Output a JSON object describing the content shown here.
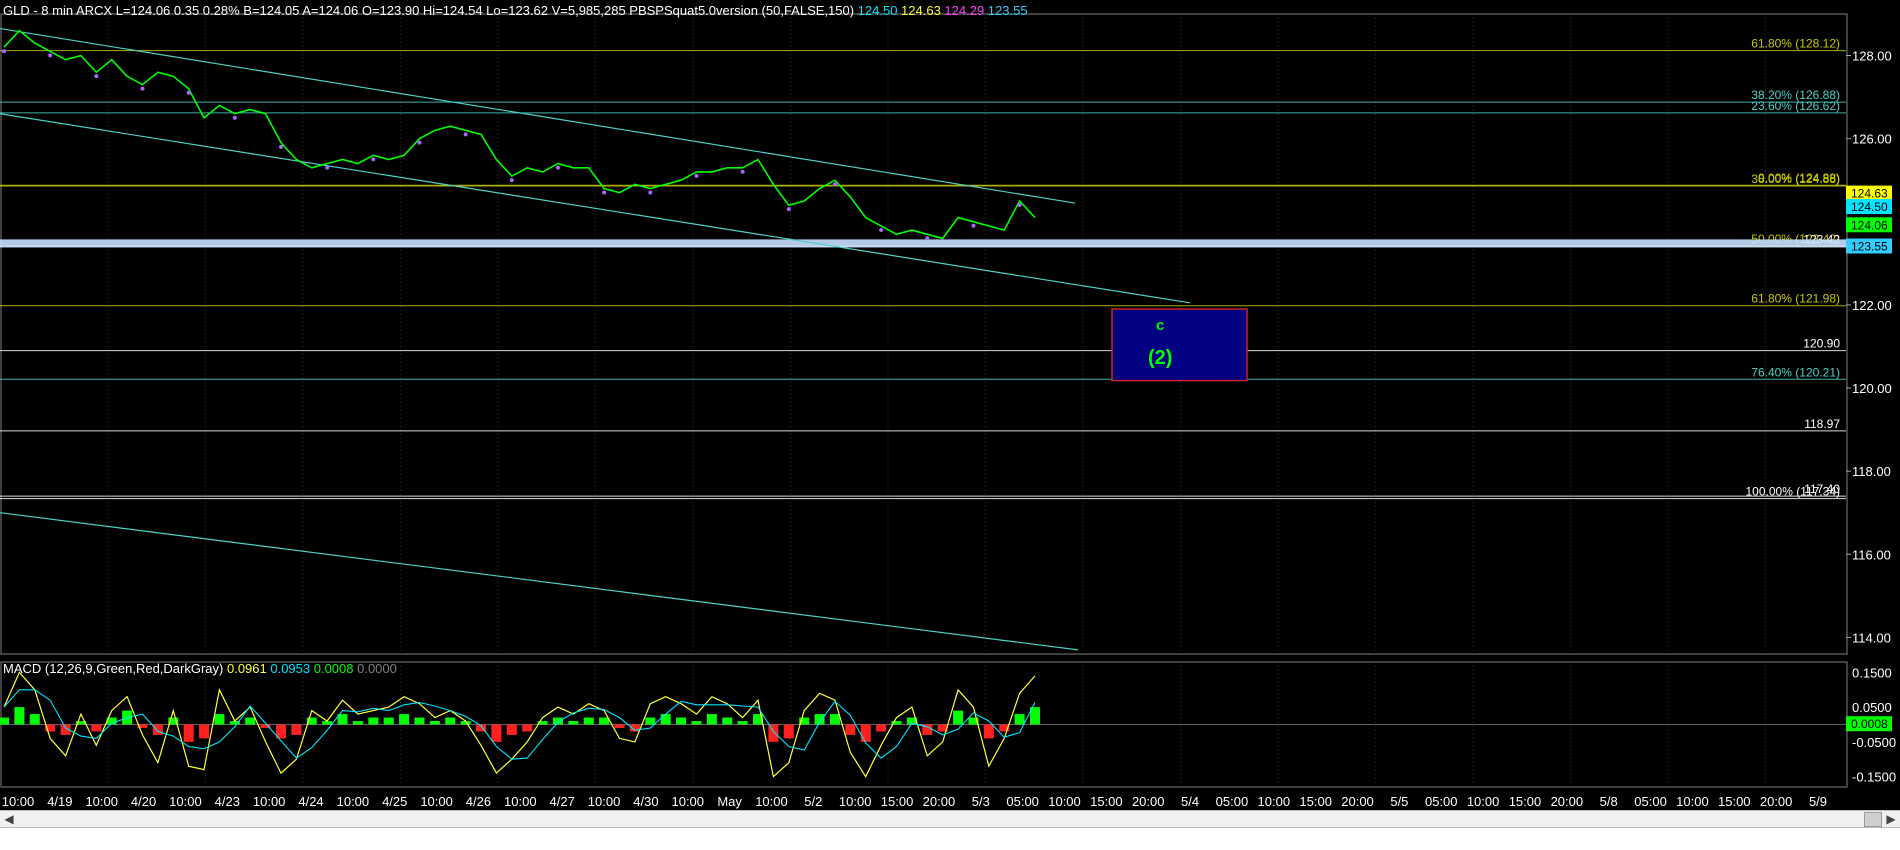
{
  "header": {
    "parts": [
      {
        "text": "GLD - 8 min  ARCX  L=124.06  0.35   0.28%",
        "color": "#ffffff"
      },
      {
        "text": "B=124.05  A=124.06  O=123.90  Hi=124.54  Lo=123.62  V=5,985,285  PBSPSquat5.0version (50,FALSE,150)",
        "color": "#ffffff"
      },
      {
        "text": "124.50",
        "color": "#00e5ff"
      },
      {
        "text": "124.63",
        "color": "#ffff33"
      },
      {
        "text": "124.29",
        "color": "#ff44ff"
      },
      {
        "text": "123.55",
        "color": "#33ccff"
      }
    ]
  },
  "macd_header": {
    "parts": [
      {
        "text": "MACD (12,26,9,Green,Red,DarkGray)",
        "color": "#ffffff"
      },
      {
        "text": "0.0961",
        "color": "#ffff33"
      },
      {
        "text": "0.0953",
        "color": "#00e5ff"
      },
      {
        "text": "0.0008",
        "color": "#00ff00"
      },
      {
        "text": "0.0000",
        "color": "#808080"
      }
    ]
  },
  "price_axis": {
    "ticks": [
      "128.00",
      "126.00",
      "124.00",
      "122.00",
      "120.00",
      "118.00",
      "116.00",
      "114.00"
    ]
  },
  "macd_axis": {
    "ticks": [
      "0.1500",
      "0.0500",
      "-0.0500",
      "-0.1500"
    ]
  },
  "price_tags": [
    {
      "text": "124.63",
      "color": "#ffff00",
      "text_color": "#000"
    },
    {
      "text": "124.50",
      "color": "#00e5ff",
      "text_color": "#000"
    },
    {
      "text": "124.06",
      "color": "#00ff00",
      "text_color": "#000"
    },
    {
      "text": "123.55",
      "color": "#33ccff",
      "text_color": "#000"
    }
  ],
  "macd_tag": {
    "text": "0.0008",
    "color": "#00ff00",
    "text_color": "#000"
  },
  "x_labels": [
    "10:00",
    "4/19",
    "10:00",
    "4/20",
    "10:00",
    "4/23",
    "10:00",
    "4/24",
    "10:00",
    "4/25",
    "10:00",
    "4/26",
    "10:00",
    "4/27",
    "10:00",
    "4/30",
    "10:00",
    "May",
    "10:00",
    "5/2",
    "10:00",
    "15:00",
    "20:00",
    "5/3",
    "05:00",
    "10:00",
    "15:00",
    "20:00",
    "5/4",
    "05:00",
    "10:00",
    "15:00",
    "20:00",
    "5/5",
    "05:00",
    "10:00",
    "15:00",
    "20:00",
    "5/8",
    "05:00",
    "10:00",
    "15:00",
    "20:00",
    "5/9"
  ],
  "fib_levels": [
    {
      "label": "61.80% (128.12)",
      "price": 128.12,
      "color": "#c8c800"
    },
    {
      "label": "38.20% (126.88)",
      "price": 126.88,
      "color": "#4fd0c8"
    },
    {
      "label": "23.60% (126.62)",
      "price": 126.62,
      "color": "#4fd0c8"
    },
    {
      "label": "0.00% (124.88)",
      "price": 124.88,
      "color": "#c8c800"
    },
    {
      "label": "38.00% (124.88)",
      "price": 124.86,
      "color": "#c8c800"
    },
    {
      "label": "50.00% (123.42)",
      "price": 123.42,
      "color": "#c8c800"
    },
    {
      "label": "123.42",
      "price": 123.4,
      "color": "#ffffff"
    },
    {
      "label": "61.80% (121.98)",
      "price": 121.98,
      "color": "#c8c800"
    },
    {
      "label": "120.90",
      "price": 120.9,
      "color": "#ffffff"
    },
    {
      "label": "76.40% (120.21)",
      "price": 120.21,
      "color": "#4fd0c8"
    },
    {
      "label": "118.97",
      "price": 118.97,
      "color": "#ffffff"
    },
    {
      "label": "100.00% (117.34)",
      "price": 117.34,
      "color": "#ffffff"
    },
    {
      "label": "117.40",
      "price": 117.4,
      "color": "#ffffff"
    }
  ],
  "target_box": {
    "label_top": "c",
    "label_bottom": "(2)",
    "price_top": 121.9,
    "price_bottom": 120.18,
    "fill": "#000080",
    "border": "#cc2222",
    "label_color": "#00ff00"
  },
  "chart_data": {
    "type": "line",
    "symbol": "GLD",
    "price_ylim": [
      113.6,
      129.0
    ],
    "macd_ylim": [
      -0.18,
      0.18
    ],
    "price_series": [
      {
        "x": 0,
        "y": 128.2
      },
      {
        "x": 1,
        "y": 128.6
      },
      {
        "x": 2,
        "y": 128.3
      },
      {
        "x": 3,
        "y": 128.1
      },
      {
        "x": 4,
        "y": 127.9
      },
      {
        "x": 5,
        "y": 128.0
      },
      {
        "x": 6,
        "y": 127.6
      },
      {
        "x": 7,
        "y": 127.9
      },
      {
        "x": 8,
        "y": 127.5
      },
      {
        "x": 9,
        "y": 127.3
      },
      {
        "x": 10,
        "y": 127.6
      },
      {
        "x": 11,
        "y": 127.5
      },
      {
        "x": 12,
        "y": 127.2
      },
      {
        "x": 13,
        "y": 126.5
      },
      {
        "x": 14,
        "y": 126.8
      },
      {
        "x": 15,
        "y": 126.6
      },
      {
        "x": 16,
        "y": 126.7
      },
      {
        "x": 17,
        "y": 126.6
      },
      {
        "x": 18,
        "y": 125.9
      },
      {
        "x": 19,
        "y": 125.5
      },
      {
        "x": 20,
        "y": 125.3
      },
      {
        "x": 21,
        "y": 125.4
      },
      {
        "x": 22,
        "y": 125.5
      },
      {
        "x": 23,
        "y": 125.4
      },
      {
        "x": 24,
        "y": 125.6
      },
      {
        "x": 25,
        "y": 125.5
      },
      {
        "x": 26,
        "y": 125.6
      },
      {
        "x": 27,
        "y": 126.0
      },
      {
        "x": 28,
        "y": 126.2
      },
      {
        "x": 29,
        "y": 126.3
      },
      {
        "x": 30,
        "y": 126.2
      },
      {
        "x": 31,
        "y": 126.1
      },
      {
        "x": 32,
        "y": 125.5
      },
      {
        "x": 33,
        "y": 125.1
      },
      {
        "x": 34,
        "y": 125.3
      },
      {
        "x": 35,
        "y": 125.2
      },
      {
        "x": 36,
        "y": 125.4
      },
      {
        "x": 37,
        "y": 125.3
      },
      {
        "x": 38,
        "y": 125.3
      },
      {
        "x": 39,
        "y": 124.8
      },
      {
        "x": 40,
        "y": 124.7
      },
      {
        "x": 41,
        "y": 124.9
      },
      {
        "x": 42,
        "y": 124.8
      },
      {
        "x": 43,
        "y": 124.9
      },
      {
        "x": 44,
        "y": 125.0
      },
      {
        "x": 45,
        "y": 125.2
      },
      {
        "x": 46,
        "y": 125.2
      },
      {
        "x": 47,
        "y": 125.3
      },
      {
        "x": 48,
        "y": 125.3
      },
      {
        "x": 49,
        "y": 125.5
      },
      {
        "x": 50,
        "y": 124.9
      },
      {
        "x": 51,
        "y": 124.4
      },
      {
        "x": 52,
        "y": 124.5
      },
      {
        "x": 53,
        "y": 124.8
      },
      {
        "x": 54,
        "y": 125.0
      },
      {
        "x": 55,
        "y": 124.6
      },
      {
        "x": 56,
        "y": 124.1
      },
      {
        "x": 57,
        "y": 123.9
      },
      {
        "x": 58,
        "y": 123.7
      },
      {
        "x": 59,
        "y": 123.8
      },
      {
        "x": 60,
        "y": 123.7
      },
      {
        "x": 61,
        "y": 123.6
      },
      {
        "x": 62,
        "y": 124.1
      },
      {
        "x": 63,
        "y": 124.0
      },
      {
        "x": 64,
        "y": 123.9
      },
      {
        "x": 65,
        "y": 123.8
      },
      {
        "x": 66,
        "y": 124.5
      },
      {
        "x": 67,
        "y": 124.1
      }
    ],
    "price_x_range": [
      0,
      67
    ],
    "macd_hist": [
      0.02,
      0.05,
      0.03,
      -0.02,
      -0.03,
      0.01,
      -0.02,
      0.02,
      0.04,
      -0.01,
      -0.03,
      0.02,
      -0.05,
      -0.04,
      0.03,
      0.01,
      0.02,
      -0.01,
      -0.04,
      -0.03,
      0.02,
      0.01,
      0.03,
      0.01,
      0.02,
      0.02,
      0.03,
      0.02,
      0.01,
      0.02,
      0.01,
      -0.02,
      -0.05,
      -0.03,
      -0.02,
      0.01,
      0.02,
      0.01,
      0.02,
      0.02,
      -0.01,
      -0.02,
      0.02,
      0.03,
      0.02,
      0.01,
      0.03,
      0.02,
      0.01,
      0.03,
      -0.05,
      -0.04,
      0.02,
      0.03,
      0.03,
      -0.03,
      -0.05,
      -0.02,
      0.01,
      0.02,
      -0.03,
      -0.02,
      0.04,
      0.02,
      -0.04,
      -0.02,
      0.03,
      0.05
    ],
    "macd_line": [
      0.05,
      0.15,
      0.1,
      -0.04,
      -0.09,
      0.03,
      -0.06,
      0.04,
      0.08,
      -0.03,
      -0.11,
      0.04,
      -0.12,
      -0.13,
      0.1,
      0.01,
      0.05,
      -0.05,
      -0.14,
      -0.1,
      0.04,
      0.01,
      0.07,
      0.03,
      0.04,
      0.05,
      0.08,
      0.06,
      0.02,
      0.04,
      0.01,
      -0.06,
      -0.14,
      -0.1,
      -0.05,
      0.02,
      0.05,
      0.03,
      0.06,
      0.04,
      -0.04,
      -0.05,
      0.06,
      0.08,
      0.06,
      0.03,
      0.08,
      0.06,
      0.02,
      0.07,
      -0.15,
      -0.11,
      0.04,
      0.09,
      0.07,
      -0.08,
      -0.15,
      -0.06,
      0.02,
      0.05,
      -0.09,
      -0.05,
      0.1,
      0.05,
      -0.12,
      -0.04,
      0.09,
      0.14
    ]
  }
}
